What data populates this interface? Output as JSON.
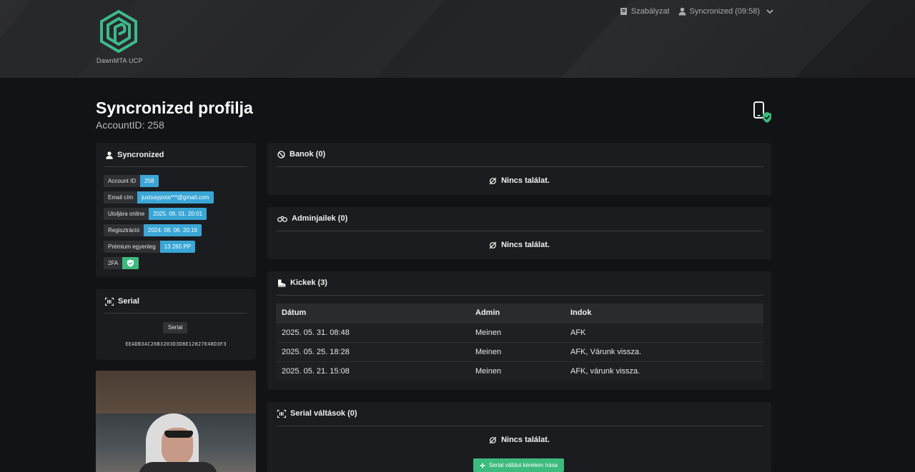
{
  "brand": {
    "name": "DawnMTA UCP",
    "accent": "#3dba8a"
  },
  "nav": {
    "rules_label": "Szabályzat",
    "user_label": "Syncronized (09:58)"
  },
  "header": {
    "title": "Syncronized profilja",
    "subtitle": "AccountID: 258"
  },
  "profile": {
    "name": "Syncronized",
    "fields": [
      {
        "key": "Account ID",
        "value": "258"
      },
      {
        "key": "Email cím",
        "value": "justsaypota***@gmail.com"
      },
      {
        "key": "Utoljára online",
        "value": "2025. 06. 01. 20:01"
      },
      {
        "key": "Regisztráció",
        "value": "2024. 08. 06. 20:16"
      },
      {
        "key": "Prémium egyenleg",
        "value": "13 265 PP"
      },
      {
        "key": "2FA",
        "value_icon": "shield-check-icon"
      }
    ]
  },
  "serial_card": {
    "title": "Serial",
    "badge": "Serial",
    "value": "EEADB3AC26B3203D3D8E12827E48D3F3"
  },
  "bans": {
    "title": "Banok (0)",
    "empty": "Nincs találat."
  },
  "adminjail": {
    "title": "Adminjailek (0)",
    "empty": "Nincs találat."
  },
  "kicks": {
    "title": "Kickek (3)",
    "columns": [
      "Dátum",
      "Admin",
      "Indok"
    ],
    "rows": [
      [
        "2025. 05. 31. 08:48",
        "Meinen",
        "AFK"
      ],
      [
        "2025. 05. 25. 18:28",
        "Meinen",
        "AFK, Várunk vissza."
      ],
      [
        "2025. 05. 21. 15:08",
        "Meinen",
        "AFK, várunk vissza."
      ]
    ]
  },
  "serial_changes": {
    "title": "Serial váltások (0)",
    "empty": "Nincs találat.",
    "button": "Serial váltási kérelem írása"
  }
}
